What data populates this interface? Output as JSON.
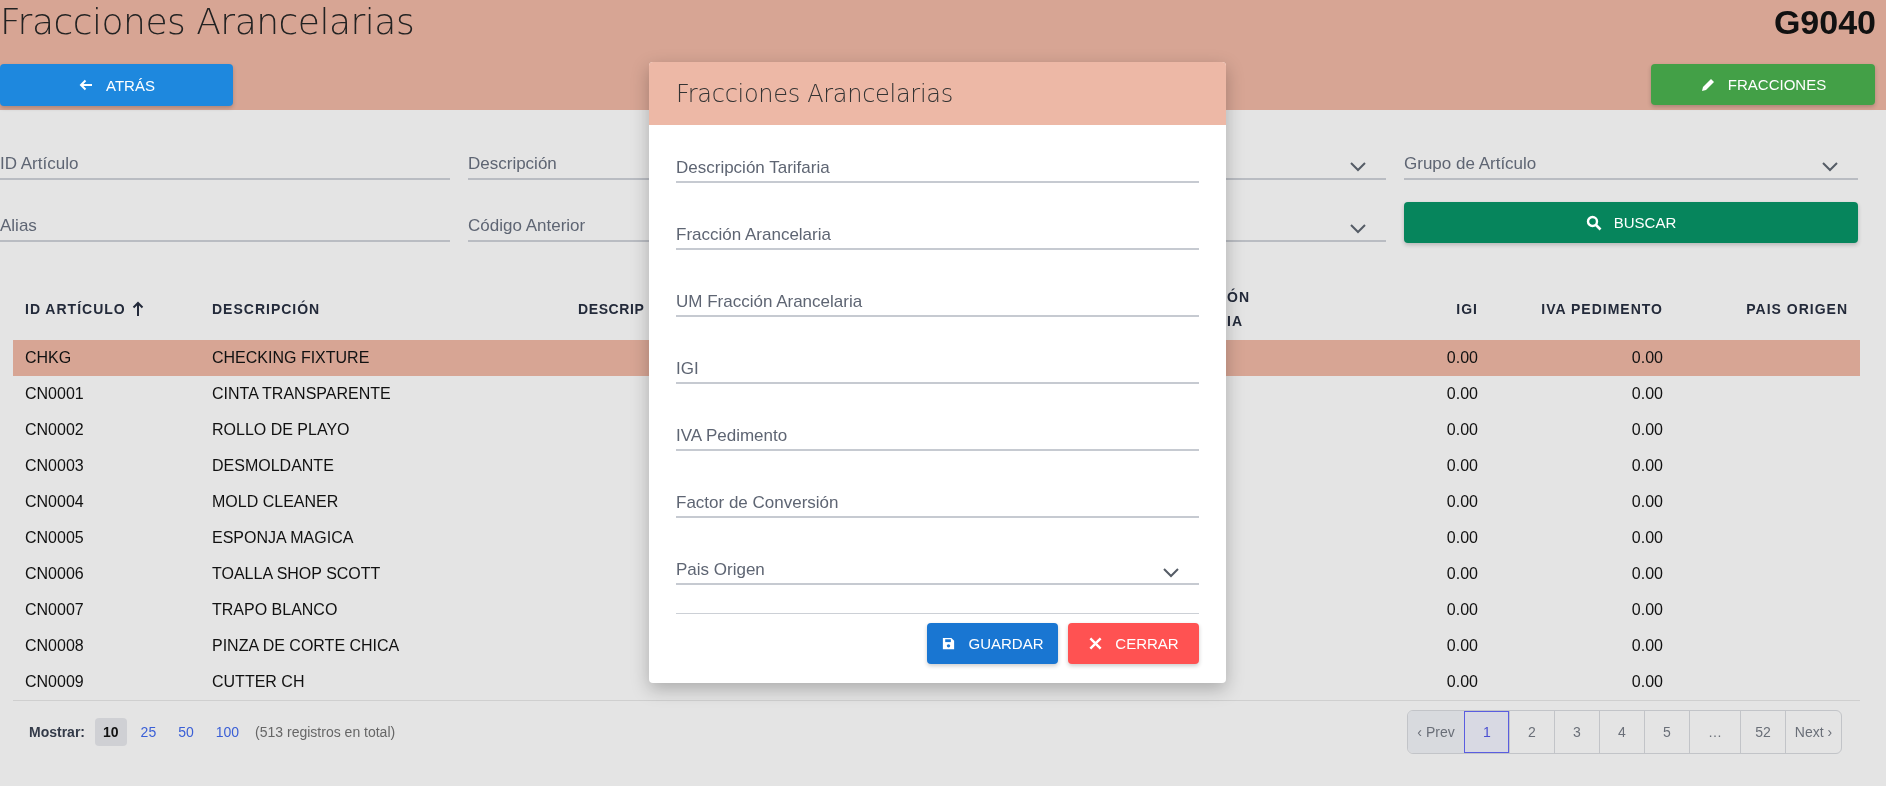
{
  "header": {
    "title": "Fracciones Arancelarias",
    "code": "G9040",
    "back_button": "ATRÁS",
    "fractions_button": "FRACCIONES"
  },
  "filters": [
    {
      "kind": "text",
      "label": "ID Artículo"
    },
    {
      "kind": "text",
      "label": "Descripción"
    },
    {
      "kind": "select"
    },
    {
      "kind": "select",
      "label": "Grupo de Artículo"
    },
    {
      "kind": "text",
      "label": "Alias"
    },
    {
      "kind": "text",
      "label": "Código Anterior"
    },
    {
      "kind": "select"
    }
  ],
  "search_button": "BUSCAR",
  "table": {
    "columns": [
      {
        "label": "ID ARTÍCULO",
        "sorted": true
      },
      {
        "label": "DESCRIPCIÓN",
        "sorted": false
      },
      {
        "label": "DESCRIP",
        "sorted": false
      },
      {
        "label": "ÓN\nIA",
        "sorted": false
      },
      {
        "label": "IGI",
        "sorted": false
      },
      {
        "label": "IVA PEDIMENTO",
        "sorted": false
      },
      {
        "label": "PAIS ORIGEN",
        "sorted": false
      }
    ],
    "rows": [
      {
        "id": "CHKG",
        "description": "CHECKING FIXTURE",
        "igi": "0.00",
        "iva": "0.00",
        "selected": true
      },
      {
        "id": "CN0001",
        "description": "CINTA TRANSPARENTE",
        "igi": "0.00",
        "iva": "0.00",
        "selected": false
      },
      {
        "id": "CN0002",
        "description": "ROLLO DE PLAYO",
        "igi": "0.00",
        "iva": "0.00",
        "selected": false
      },
      {
        "id": "CN0003",
        "description": "DESMOLDANTE",
        "igi": "0.00",
        "iva": "0.00",
        "selected": false
      },
      {
        "id": "CN0004",
        "description": "MOLD CLEANER",
        "igi": "0.00",
        "iva": "0.00",
        "selected": false
      },
      {
        "id": "CN0005",
        "description": "ESPONJA MAGICA",
        "igi": "0.00",
        "iva": "0.00",
        "selected": false
      },
      {
        "id": "CN0006",
        "description": "TOALLA SHOP SCOTT",
        "igi": "0.00",
        "iva": "0.00",
        "selected": false
      },
      {
        "id": "CN0007",
        "description": "TRAPO BLANCO",
        "igi": "0.00",
        "iva": "0.00",
        "selected": false
      },
      {
        "id": "CN0008",
        "description": "PINZA DE CORTE CHICA",
        "igi": "0.00",
        "iva": "0.00",
        "selected": false
      },
      {
        "id": "CN0009",
        "description": "CUTTER CH",
        "igi": "0.00",
        "iva": "0.00",
        "selected": false
      }
    ]
  },
  "footer": {
    "show_label": "Mostrar:",
    "page_sizes": [
      {
        "label": "10",
        "selected": true
      },
      {
        "label": "25",
        "selected": false
      },
      {
        "label": "50",
        "selected": false
      },
      {
        "label": "100",
        "selected": false
      }
    ],
    "total": "(513 registros en total)",
    "pagination": [
      {
        "kind": "nav",
        "label": "‹ Prev",
        "selected": false
      },
      {
        "kind": "page",
        "label": "1",
        "selected": true
      },
      {
        "kind": "page",
        "label": "2",
        "selected": false
      },
      {
        "kind": "page",
        "label": "3",
        "selected": false
      },
      {
        "kind": "page",
        "label": "4",
        "selected": false
      },
      {
        "kind": "page",
        "label": "5",
        "selected": false
      },
      {
        "kind": "gap",
        "label": "…"
      },
      {
        "kind": "page",
        "label": "52",
        "selected": false
      },
      {
        "kind": "nav",
        "label": "Next ›",
        "selected": false
      }
    ]
  },
  "dialog": {
    "title": "Fracciones Arancelarias",
    "fields": [
      {
        "kind": "text",
        "label": "Descripción Tarifaria"
      },
      {
        "kind": "text",
        "label": "Fracción Arancelaria"
      },
      {
        "kind": "text",
        "label": "UM Fracción Arancelaria"
      },
      {
        "kind": "text",
        "label": "IGI"
      },
      {
        "kind": "text",
        "label": "IVA Pedimento"
      },
      {
        "kind": "text",
        "label": "Factor de Conversión"
      },
      {
        "kind": "select",
        "label": "Pais Origen"
      }
    ],
    "save_button": "GUARDAR",
    "close_button": "CERRAR"
  }
}
